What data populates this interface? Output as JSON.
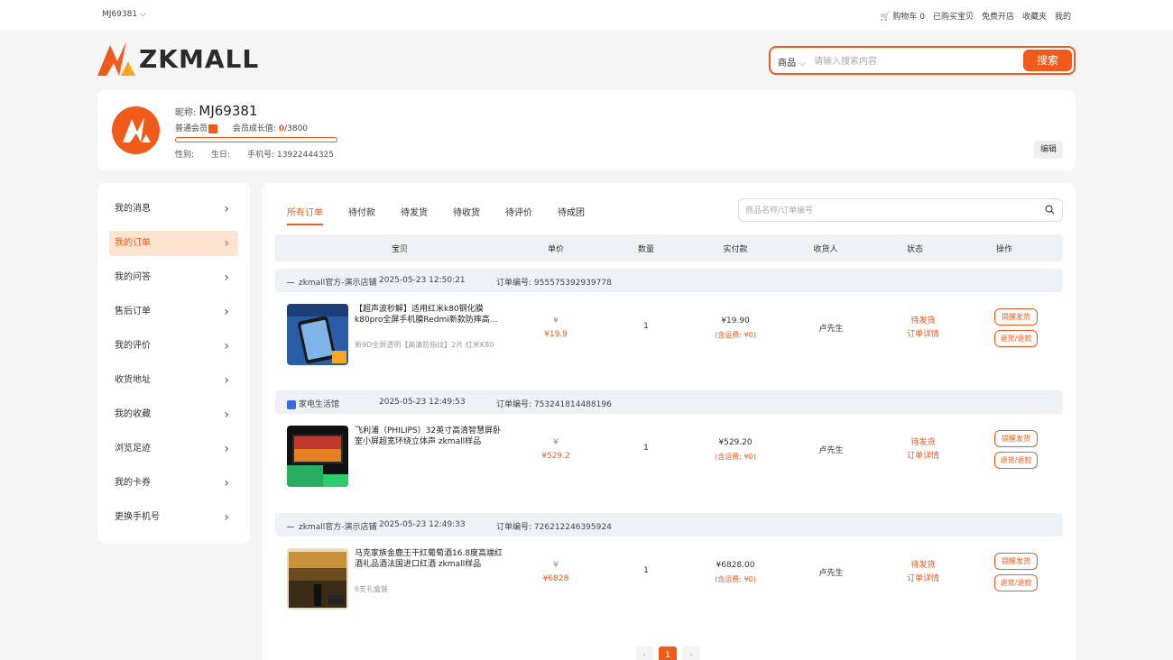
{
  "topbar": {
    "username": "MJ69381",
    "cart_label": "购物车",
    "cart_count": "0",
    "bought_label": "已购买宝贝",
    "open_shop_label": "免费开店",
    "favorites_label": "收藏夹",
    "mine_label": "我的"
  },
  "header": {
    "logo_text": "ZKMALL",
    "search_category": "商品",
    "search_placeholder": "请输入搜索内容",
    "search_button": "搜索"
  },
  "profile": {
    "nick_label": "昵称:",
    "nick_value": "MJ69381",
    "member_level": "普通会员",
    "growth_label": "会员成长值:",
    "growth_current": "0",
    "growth_total": "/3800",
    "growth_fraction": 0,
    "gender_label": "性别:",
    "birthday_label": "生日:",
    "phone_label": "手机号:",
    "phone_value": "13922444325",
    "edit_button": "编辑"
  },
  "sidebar": {
    "items": [
      {
        "label": "我的消息"
      },
      {
        "label": "我的订单"
      },
      {
        "label": "我的问答"
      },
      {
        "label": "售后订单"
      },
      {
        "label": "我的评价"
      },
      {
        "label": "收货地址"
      },
      {
        "label": "我的收藏"
      },
      {
        "label": "浏览足迹"
      },
      {
        "label": "我的卡券"
      },
      {
        "label": "更换手机号"
      }
    ],
    "active_index": 1
  },
  "orders": {
    "tabs": [
      "所有订单",
      "待付款",
      "待发货",
      "待收货",
      "待评价",
      "待成团"
    ],
    "active_tab": 0,
    "search_placeholder": "商品名称/订单编号",
    "columns": [
      "宝贝",
      "单价",
      "数量",
      "实付款",
      "收货人",
      "状态",
      "操作"
    ],
    "list": [
      {
        "shop": "zkmall官方-演示店铺",
        "time": "2025-05-23 12:50:21",
        "order_no_label": "订单编号:",
        "order_no": "955575392939778",
        "product_name": "【超声波秒解】适用红米k80钢化膜k80pro全屏手机膜Redmi新款防摔高...",
        "spec": "新9D全屏透明【高清防指纹】2片   红米K80",
        "price_symbol": "¥",
        "price": "¥19.9",
        "quantity": "1",
        "paid": "¥19.90",
        "shipping": "(含运费: ¥0)",
        "receiver": "卢先生",
        "status": "待发货",
        "detail_link": "订单详情",
        "btn_remind": "提醒发货",
        "btn_refund": "退货/退款"
      },
      {
        "shop": "家电生活馆",
        "time": "2025-05-23 12:49:53",
        "order_no_label": "订单编号:",
        "order_no": "753241814488196",
        "product_name": "飞利浦（PHILIPS）32英寸高清智慧屏卧室小屏超宽环绕立体声 zkmall样品",
        "spec": "",
        "price_symbol": "¥",
        "price": "¥529.2",
        "quantity": "1",
        "paid": "¥529.20",
        "shipping": "(含运费: ¥0)",
        "receiver": "卢先生",
        "status": "待发货",
        "detail_link": "订单详情",
        "btn_remind": "提醒发货",
        "btn_refund": "退货/退款"
      },
      {
        "shop": "zkmall官方-演示店铺",
        "time": "2025-05-23 12:49:33",
        "order_no_label": "订单编号:",
        "order_no": "726212246395924",
        "product_name": "马克家族金鹿王干红葡萄酒16.8度高端红酒礼品酒法国进口红酒 zkmall样品",
        "spec": "6支礼盒装",
        "price_symbol": "¥",
        "price": "¥6828",
        "quantity": "1",
        "paid": "¥6828.00",
        "shipping": "(含运费: ¥0)",
        "receiver": "卢先生",
        "status": "待发货",
        "detail_link": "订单详情",
        "btn_remind": "提醒发货",
        "btn_refund": "退货/退款"
      }
    ]
  },
  "pagination": {
    "prev": "‹",
    "current": "1",
    "next": "›"
  },
  "colors": {
    "accent": "#f05a1a",
    "background": "#f5f5f5",
    "header_row": "#eef1f6"
  }
}
